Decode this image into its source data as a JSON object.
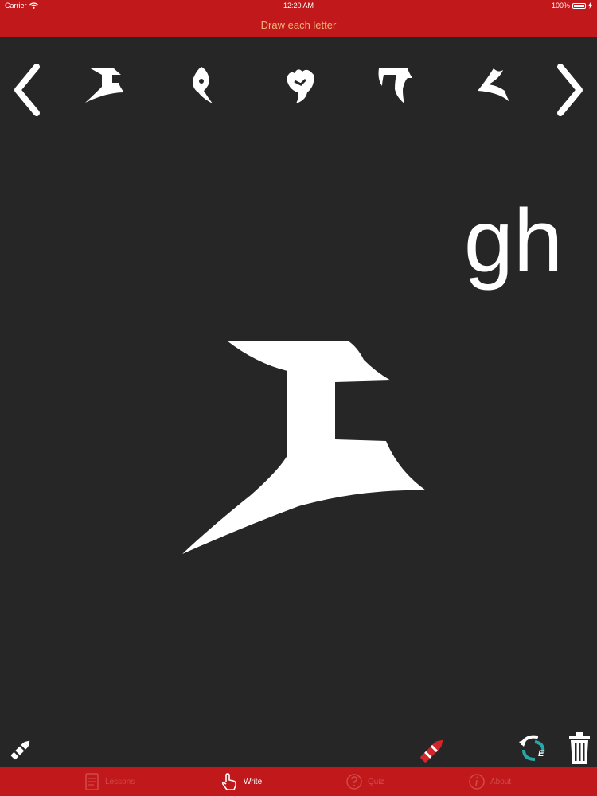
{
  "status_bar": {
    "carrier": "Carrier",
    "time": "12:20 AM",
    "battery": "100%"
  },
  "nav": {
    "title": "Draw each letter"
  },
  "letter_strip": {
    "prev_icon": "chevron-left-icon",
    "next_icon": "chevron-right-icon",
    "glyphs": [
      "klingon-gh-glyph",
      "klingon-i-glyph",
      "klingon-j-glyph",
      "klingon-l-glyph",
      "klingon-m-glyph"
    ]
  },
  "current_letter": {
    "latin": "gh",
    "glyph": "klingon-gh-glyph"
  },
  "tools": {
    "left": "white-crayon-icon",
    "middle": "red-crayon-icon",
    "refresh": "refresh-icon",
    "refresh_label": "E",
    "trash": "trash-icon"
  },
  "tabs": [
    {
      "label": "Lessons",
      "icon": "book-icon",
      "active": false
    },
    {
      "label": "Write",
      "icon": "hand-pointer-icon",
      "active": true
    },
    {
      "label": "Quiz",
      "icon": "question-icon",
      "active": false
    },
    {
      "label": "About",
      "icon": "info-icon",
      "active": false
    }
  ],
  "colors": {
    "accent": "#c1191b",
    "background": "#262626",
    "title_text": "#f2b27a",
    "inactive_tab": "#d24a4a"
  }
}
